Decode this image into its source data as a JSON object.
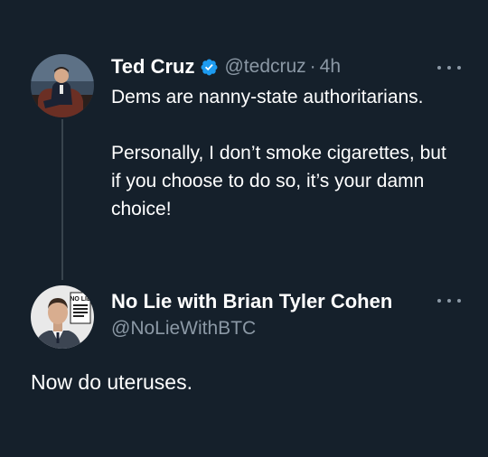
{
  "tweet": {
    "author_name": "Ted Cruz",
    "verified_icon": "verified-badge-icon",
    "handle": "@tedcruz",
    "separator": "·",
    "time": "4h",
    "paragraph_1": "Dems are nanny-state authoritarians.",
    "paragraph_2": "Personally, I don’t smoke cigarettes, but if you choose to do so, it’s your damn choice!"
  },
  "reply": {
    "author_name": "No Lie with Brian Tyler Cohen",
    "handle": "@NoLieWithBTC",
    "text": "Now do uteruses.",
    "avatar_logo_title": "NO LIE"
  },
  "colors": {
    "background": "#15202b",
    "text_primary": "#ffffff",
    "text_secondary": "#8b98a5",
    "verified_blue": "#1d9bf0",
    "thread_line": "#38444d"
  },
  "icons": {
    "more": "more-horizontal-icon",
    "verified": "verified-badge-icon"
  }
}
